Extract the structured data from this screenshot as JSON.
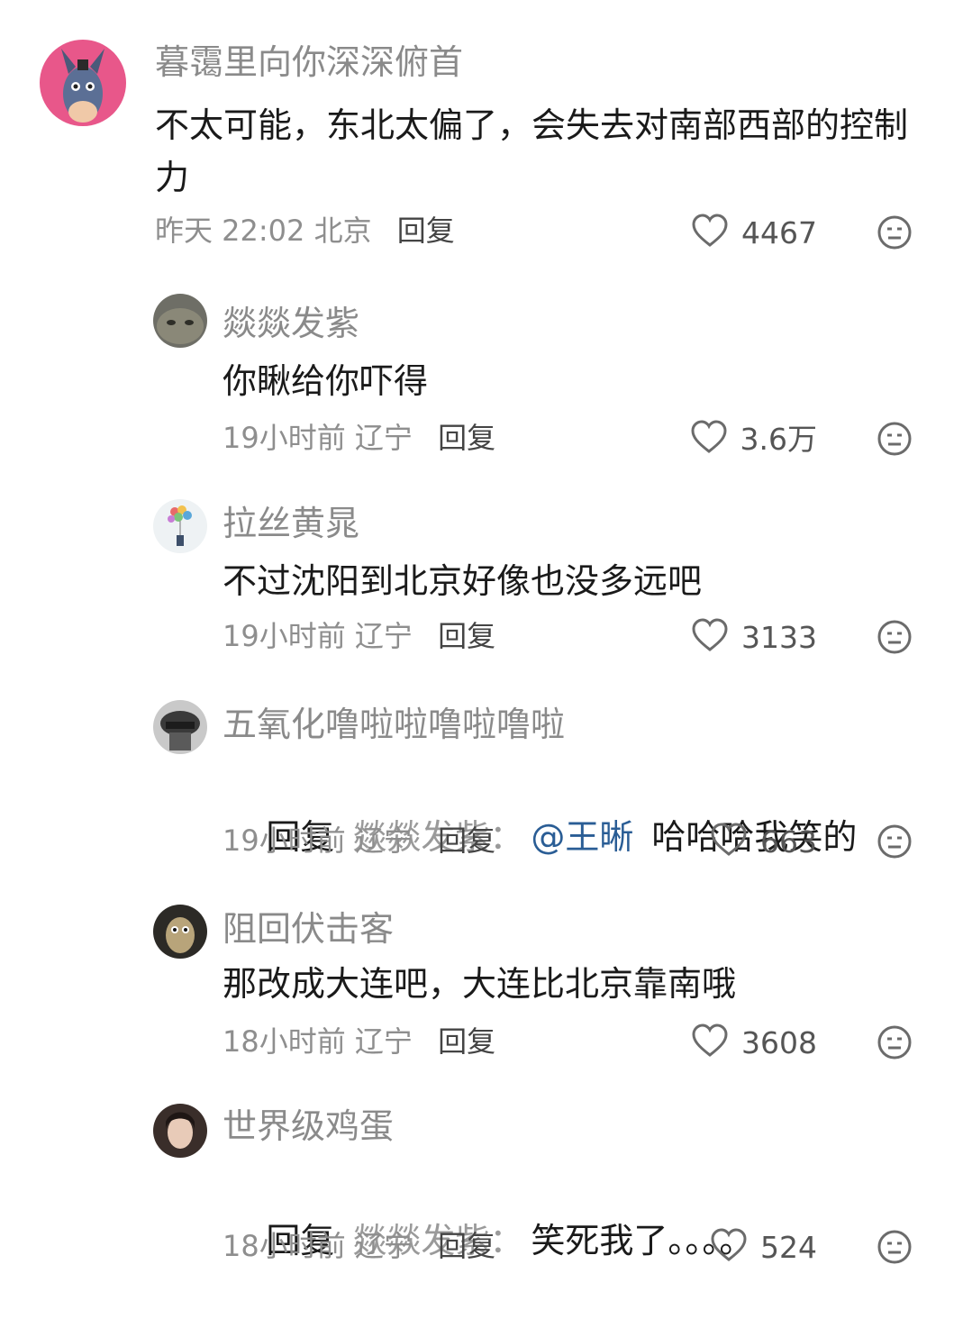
{
  "comments": [
    {
      "username": "暮霭里向你深深俯首",
      "text": "不太可能，东北太偏了，会失去对南部西部的控制力",
      "time": "昨天 22:02",
      "location": "北京",
      "reply_label": "回复",
      "likes": "4467",
      "avatar": "donkey-avatar",
      "level": "top"
    },
    {
      "username": "燚燚发紫",
      "text": "你瞅给你吓得",
      "time": "19小时前",
      "location": "辽宁",
      "reply_label": "回复",
      "likes": "3.6万",
      "avatar": "cat-avatar",
      "level": "reply"
    },
    {
      "username": "拉丝黄晁",
      "text": "不过沈阳到北京好像也没多远吧",
      "time": "19小时前",
      "location": "辽宁",
      "reply_label": "回复",
      "likes": "3133",
      "avatar": "balloons-avatar",
      "level": "reply"
    },
    {
      "username": "五氧化噜啦啦噜啦噜啦",
      "reply_prefix": "回复",
      "reply_to": "燚燚发紫：",
      "mention": "@王晰",
      "text_after": "哈哈哈我笑的",
      "time": "19小时前",
      "location": "辽宁",
      "reply_label": "回复",
      "likes": "663",
      "avatar": "helmet-avatar",
      "level": "reply"
    },
    {
      "username": "阻回伏击客",
      "text": "那改成大连吧，大连比北京靠南哦",
      "time": "18小时前",
      "location": "辽宁",
      "reply_label": "回复",
      "likes": "3608",
      "avatar": "cartoon-avatar",
      "level": "reply"
    },
    {
      "username": "世界级鸡蛋",
      "reply_prefix": "回复",
      "reply_to": "燚燚发紫：",
      "text_after": "笑死我了。。。。",
      "time": "18小时前",
      "location": "辽宁",
      "reply_label": "回复",
      "likes": "524",
      "avatar": "woman-avatar",
      "level": "reply"
    }
  ],
  "colors": {
    "username": "#8a8a8a",
    "text": "#1a1a1a",
    "mention": "#2a5d95",
    "meta": "#8e8e8e",
    "icon": "#6b6b6b"
  }
}
